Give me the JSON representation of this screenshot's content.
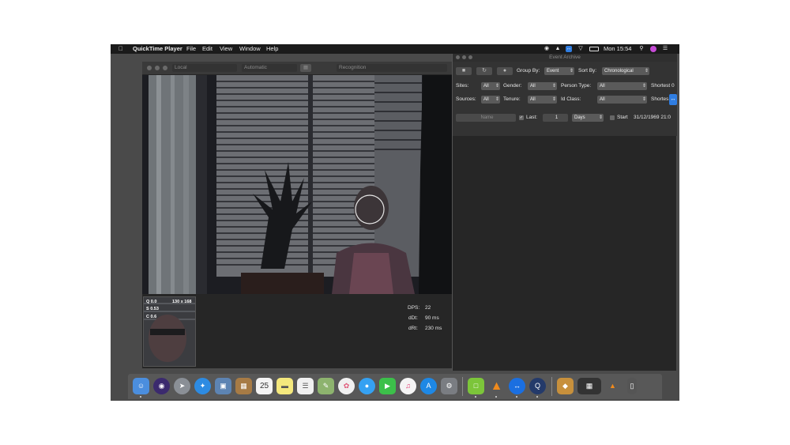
{
  "menubar": {
    "app_name": "QuickTime Player",
    "items": [
      "File",
      "Edit",
      "View",
      "Window",
      "Help"
    ],
    "clock": "Mon 15:54",
    "apple_icon": "apple-icon",
    "tray_icons": [
      "record-icon",
      "eject-icon",
      "teamviewer-icon",
      "wifi-icon",
      "battery-icon",
      "search-icon",
      "siri-icon",
      "list-icon"
    ]
  },
  "video_window": {
    "toolbar": {
      "source": "Local",
      "mode": "Automatic",
      "recognition": "Recognition"
    },
    "stats": {
      "dps_label": "DPS:",
      "dps_value": "22",
      "ddt_label": "dDt:",
      "ddt_value": "90 ms",
      "drt_label": "dRt:",
      "drt_value": "230 ms"
    },
    "thumbnail": {
      "q": "Q 0.0",
      "size": "130 x 168",
      "s": "S 0.53",
      "c": "C 0.6"
    }
  },
  "archive": {
    "title": "Event Archive",
    "group_by_label": "Group By:",
    "group_by_value": "Event",
    "sort_by_label": "Sort By:",
    "sort_by_value": "Chronological",
    "sites_label": "Sites:",
    "sites_value": "All",
    "gender_label": "Gender:",
    "gender_value": "All",
    "person_type_label": "Person Type:",
    "person_type_value": "All",
    "shortest_label_1": "Shortest 0",
    "sources_label": "Sources:",
    "sources_value": "All",
    "tenure_label": "Tenure:",
    "tenure_value": "All",
    "id_class_label": "Id Class:",
    "id_class_value": "All",
    "shortest_label_2": "Shortes",
    "name_placeholder": "Name",
    "last_label": "Last:",
    "last_value": "1",
    "unit_value": "Days",
    "start_label": "Start",
    "start_date": "31/12/1969 21:0"
  },
  "dock": {
    "apps": [
      "finder-icon",
      "siri-icon",
      "launchpad-icon",
      "safari-icon",
      "preview-icon",
      "notes-book-icon",
      "calendar-icon",
      "stickies-icon",
      "reminders-icon",
      "photos-edit-icon",
      "photos-icon",
      "messages-icon",
      "facetime-icon",
      "music-icon",
      "app-store-icon",
      "system-preferences-icon",
      "screen-app-icon",
      "vlc-icon",
      "teamviewer-icon",
      "quicktime-icon",
      "package-icon",
      "finder-window-icon",
      "vlc-small-icon",
      "trash-icon"
    ],
    "calendar_day": "25"
  },
  "colors": {
    "menubar_bg": "#1b1b1b",
    "desktop_bg": "#4a4a4a",
    "window_bg": "#262626",
    "select_bg": "#5a5a5a"
  }
}
